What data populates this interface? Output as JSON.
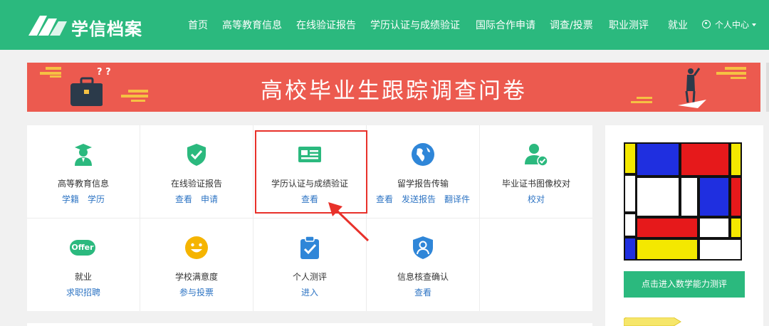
{
  "header": {
    "logo_text": "学信档案",
    "nav": [
      {
        "label": "首页"
      },
      {
        "label": "高等教育信息"
      },
      {
        "label": "在线验证报告"
      },
      {
        "label": "学历认证与成绩验证"
      },
      {
        "label": "国际合作申请"
      },
      {
        "label": "调查/投票"
      },
      {
        "label": "职业测评"
      },
      {
        "label": "就业"
      }
    ],
    "user_menu": "个人中心"
  },
  "banner": {
    "title": "高校毕业生跟踪调查问卷"
  },
  "services": [
    {
      "label": "高等教育信息",
      "icon": "graduate-icon",
      "links": [
        "学籍",
        "学历"
      ]
    },
    {
      "label": "在线验证报告",
      "icon": "shield-check-icon",
      "links": [
        "查看",
        "申请"
      ]
    },
    {
      "label": "学历认证与成绩验证",
      "icon": "id-card-icon",
      "links": [
        "查看"
      ]
    },
    {
      "label": "留学报告传输",
      "icon": "globe-icon",
      "links": [
        "查看",
        "发送报告",
        "翻译件"
      ]
    },
    {
      "label": "毕业证书图像校对",
      "icon": "user-check-icon",
      "links": [
        "校对"
      ]
    },
    {
      "label": "就业",
      "icon": "offer-icon",
      "icon_text": "Offer",
      "links": [
        "求职招聘"
      ]
    },
    {
      "label": "学校满意度",
      "icon": "smiley-icon",
      "links": [
        "参与投票"
      ]
    },
    {
      "label": "个人测评",
      "icon": "clipboard-check-icon",
      "links": [
        "进入"
      ]
    },
    {
      "label": "信息核查确认",
      "icon": "user-shield-icon",
      "links": [
        "查看"
      ]
    }
  ],
  "sidebar": {
    "button_label": "点击进入数学能力测评"
  },
  "colors": {
    "primary": "#2bb97e",
    "banner": "#ec5a4f",
    "link": "#2f75c4",
    "highlight": "#e8312a",
    "icon_blue": "#2f86d8",
    "icon_yellow": "#f5b400"
  }
}
